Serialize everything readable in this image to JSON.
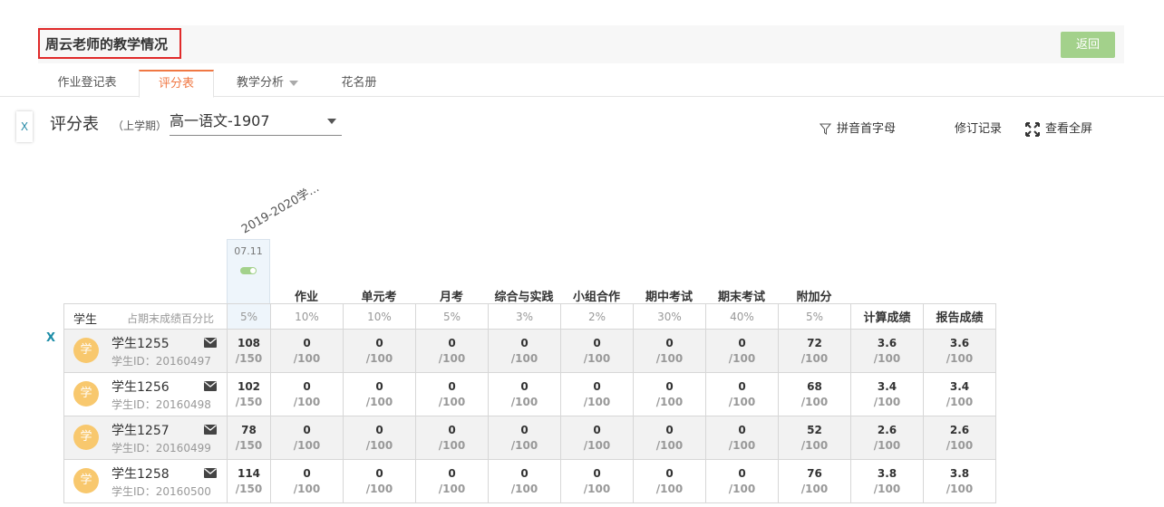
{
  "header": {
    "title": "周云老师的教学情况",
    "back_label": "返回"
  },
  "tabs": [
    {
      "label": "作业登记表"
    },
    {
      "label": "评分表"
    },
    {
      "label": "教学分析"
    },
    {
      "label": "花名册"
    }
  ],
  "sheet": {
    "side_toggle": "X",
    "title": "评分表",
    "term": "（上学期）",
    "class_selected": "高一语文-1907"
  },
  "toolbar": {
    "pinyin_label": "拼音首字母",
    "revisions_label": "修订记录",
    "fullscreen_label": "查看全屏"
  },
  "term_column": {
    "term": "2019-2020学...",
    "date": "07.11"
  },
  "columns": [
    {
      "name": "作业"
    },
    {
      "name": "单元考"
    },
    {
      "name": "月考"
    },
    {
      "name": "综合与实践"
    },
    {
      "name": "小组合作"
    },
    {
      "name": "期中考试"
    },
    {
      "name": "期末考试"
    },
    {
      "name": "附加分"
    }
  ],
  "percent_row": {
    "student_label": "学生",
    "pct_label": "占期末成绩百分比",
    "values": [
      "5%",
      "10%",
      "10%",
      "5%",
      "3%",
      "2%",
      "30%",
      "40%",
      "5%"
    ],
    "calc_label": "计算成绩",
    "report_label": "报告成绩"
  },
  "row_marker": "X",
  "avatar_char": "学",
  "students": [
    {
      "name": "学生1255",
      "id": "学生ID：20160497",
      "scores": [
        "108",
        "0",
        "0",
        "0",
        "0",
        "0",
        "0",
        "0",
        "72",
        "3.6",
        "3.6"
      ],
      "max": [
        "/150",
        "/100",
        "/100",
        "/100",
        "/100",
        "/100",
        "/100",
        "/100",
        "/100",
        "/100",
        "/100"
      ]
    },
    {
      "name": "学生1256",
      "id": "学生ID：20160498",
      "scores": [
        "102",
        "0",
        "0",
        "0",
        "0",
        "0",
        "0",
        "0",
        "68",
        "3.4",
        "3.4"
      ],
      "max": [
        "/150",
        "/100",
        "/100",
        "/100",
        "/100",
        "/100",
        "/100",
        "/100",
        "/100",
        "/100",
        "/100"
      ]
    },
    {
      "name": "学生1257",
      "id": "学生ID：20160499",
      "scores": [
        "78",
        "0",
        "0",
        "0",
        "0",
        "0",
        "0",
        "0",
        "52",
        "2.6",
        "2.6"
      ],
      "max": [
        "/150",
        "/100",
        "/100",
        "/100",
        "/100",
        "/100",
        "/100",
        "/100",
        "/100",
        "/100",
        "/100"
      ]
    },
    {
      "name": "学生1258",
      "id": "学生ID：20160500",
      "scores": [
        "114",
        "0",
        "0",
        "0",
        "0",
        "0",
        "0",
        "0",
        "76",
        "3.8",
        "3.8"
      ],
      "max": [
        "/150",
        "/100",
        "/100",
        "/100",
        "/100",
        "/100",
        "/100",
        "/100",
        "/100",
        "/100",
        "/100"
      ]
    }
  ]
}
